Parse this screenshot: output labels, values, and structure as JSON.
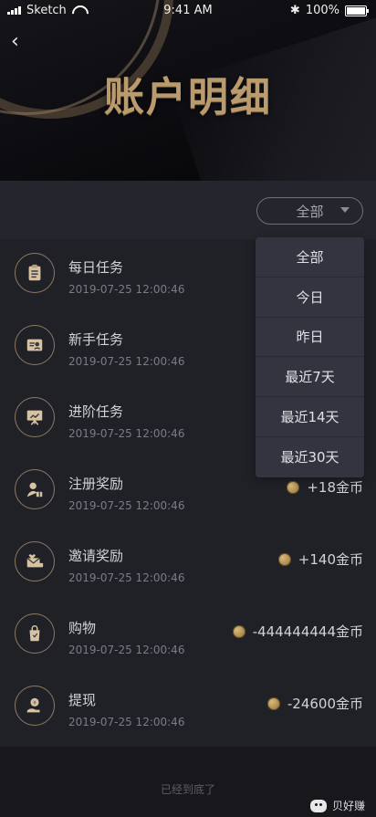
{
  "status_bar": {
    "carrier": "Sketch",
    "time": "9:41 AM",
    "battery": "100%"
  },
  "header": {
    "back_icon": "chevron-left-icon",
    "title": "账户明细"
  },
  "filter": {
    "selected": "全部",
    "options": [
      "全部",
      "今日",
      "昨日",
      "最近7天",
      "最近14天",
      "最近30天"
    ]
  },
  "transactions": [
    {
      "title": "每日任务",
      "date": "2019-07-25 12:00:46",
      "amount": "",
      "icon": "clipboard-icon"
    },
    {
      "title": "新手任务",
      "date": "2019-07-25 12:00:46",
      "amount": "",
      "icon": "user-card-icon"
    },
    {
      "title": "进阶任务",
      "date": "2019-07-25 12:00:46",
      "amount": "",
      "icon": "presentation-icon"
    },
    {
      "title": "注册奖励",
      "date": "2019-07-25 12:00:46",
      "amount": "+18金币",
      "icon": "person-gift-icon"
    },
    {
      "title": "邀请奖励",
      "date": "2019-07-25 12:00:46",
      "amount": "+140金币",
      "icon": "invite-reward-icon"
    },
    {
      "title": "购物",
      "date": "2019-07-25 12:00:46",
      "amount": "-444444444金币",
      "icon": "shopping-bag-icon"
    },
    {
      "title": "提现",
      "date": "2019-07-25 12:00:46",
      "amount": "-24600金币",
      "icon": "withdraw-icon"
    }
  ],
  "footer": {
    "end_text": "已经到底了",
    "watermark": "贝好赚"
  },
  "colors": {
    "background": "#202027",
    "accent_gold": "#b99b6e"
  }
}
